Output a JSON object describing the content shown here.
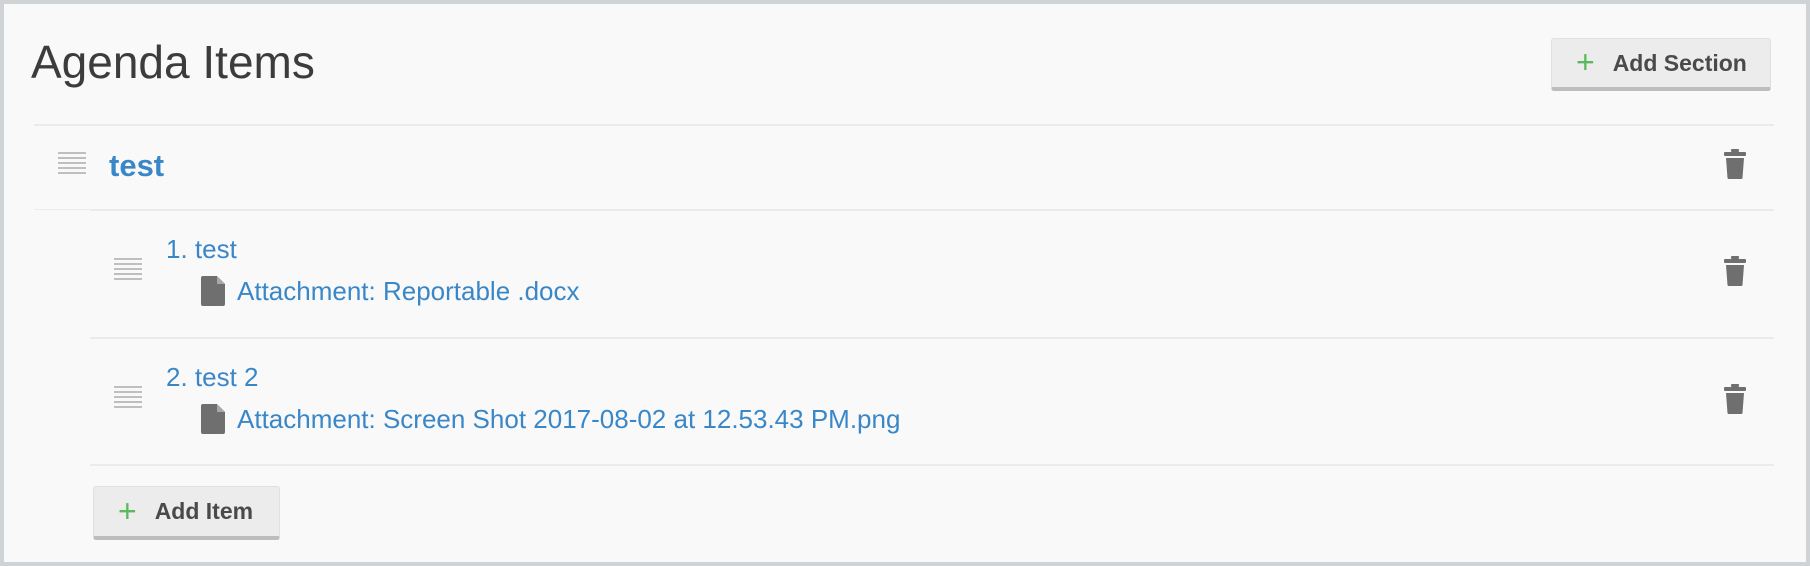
{
  "header": {
    "title": "Agenda Items",
    "add_section_label": "Add Section"
  },
  "section": {
    "title": "test",
    "items": [
      {
        "title": "1. test",
        "attachment": "Attachment: Reportable .docx"
      },
      {
        "title": "2. test 2",
        "attachment": "Attachment: Screen Shot 2017-08-02 at 12.53.43 PM.png"
      }
    ],
    "add_item_label": "Add Item"
  },
  "icons": {
    "drag": "drag-handle-icon",
    "trash": "trash-icon",
    "file": "file-icon",
    "plus": "plus-icon"
  },
  "colors": {
    "link": "#3a87c8",
    "plus": "#5cb85c",
    "icon": "#6f6f6f"
  }
}
